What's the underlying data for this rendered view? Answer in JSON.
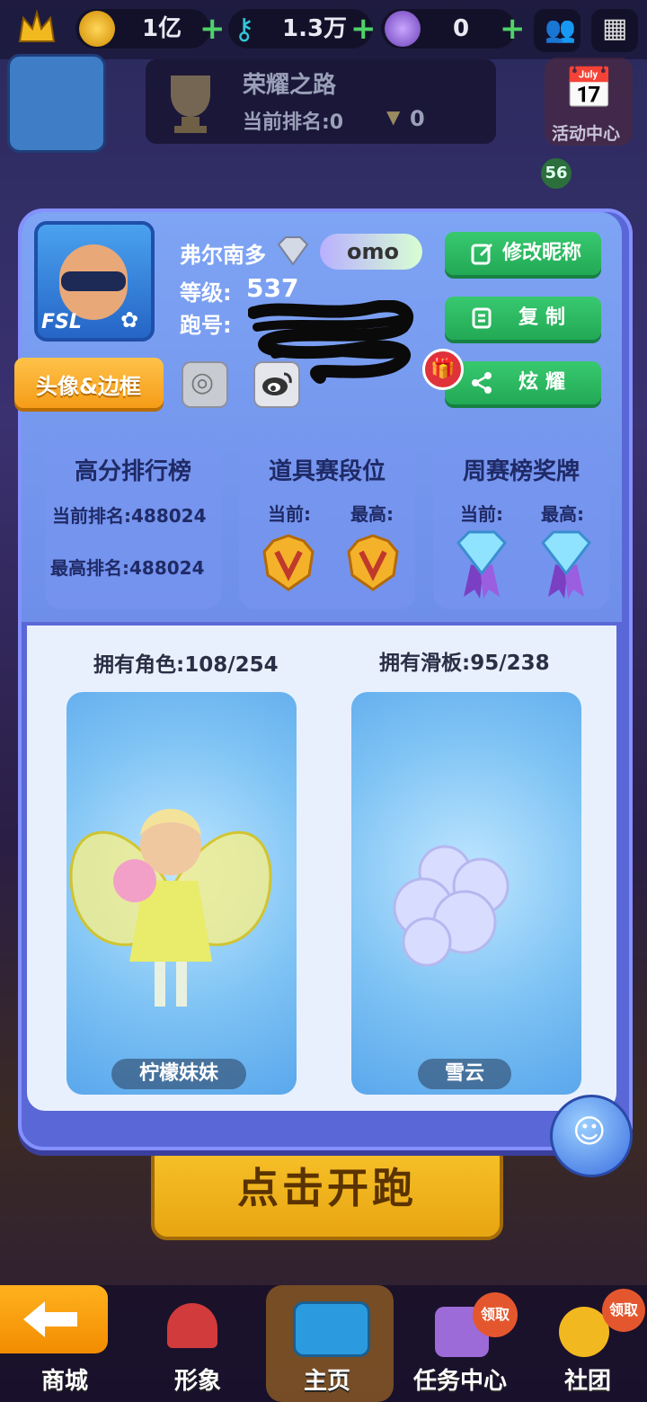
{
  "topbar": {
    "coins": "1亿",
    "keys": "1.3万",
    "tokens": "0"
  },
  "honor_road": {
    "title": "荣耀之路",
    "rank_label": "当前排名:0",
    "trophies": "0"
  },
  "event_center": {
    "label": "活动中心",
    "badge": "56"
  },
  "profile": {
    "name": "弗尔南多",
    "crew_tag": "omo",
    "level_label": "等级:",
    "level": "537",
    "id_label": "跑号:",
    "avatar_tag": "FSL",
    "frame_button": "头像&边框"
  },
  "actions": {
    "rename": "修改昵称",
    "copy": "复制",
    "share": "炫耀"
  },
  "stats": {
    "highscore": {
      "title": "高分排行榜",
      "current": "当前排名:488024",
      "best": "最高排名:488024"
    },
    "item_rank": {
      "title": "道具赛段位",
      "current_label": "当前:",
      "best_label": "最高:"
    },
    "weekly": {
      "title": "周赛榜奖牌",
      "current_label": "当前:",
      "best_label": "最高:"
    }
  },
  "collection": {
    "characters_label": "拥有角色:108/254",
    "boards_label": "拥有滑板:95/238",
    "character_name": "柠檬妹妹",
    "board_name": "雪云"
  },
  "start_button": "点击开跑",
  "bottom_nav": [
    {
      "label": "商城"
    },
    {
      "label": "形象"
    },
    {
      "label": "主页"
    },
    {
      "label": "任务中心"
    },
    {
      "label": "社团"
    }
  ],
  "badges": {
    "claim": "领取"
  },
  "colors": {
    "accent_green": "#22a955",
    "modal_blue": "#6e8ee9",
    "gold": "#f0b020"
  }
}
